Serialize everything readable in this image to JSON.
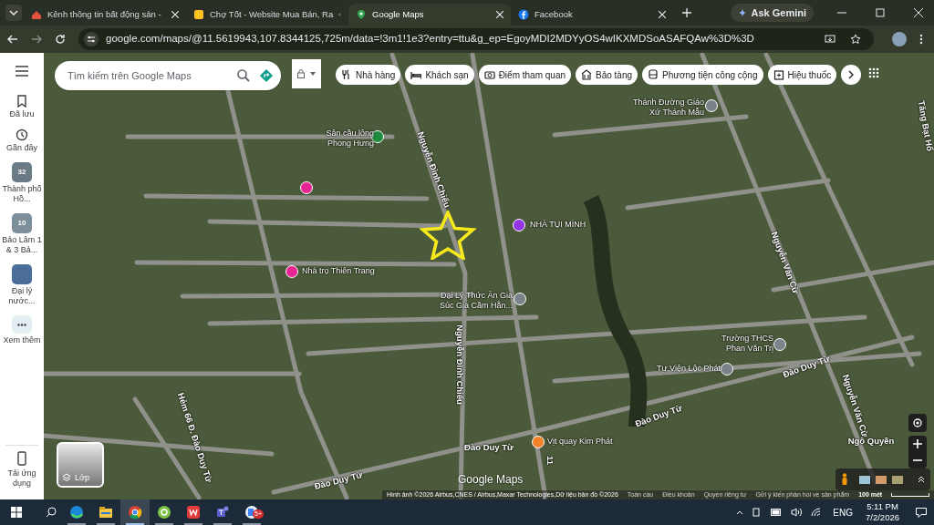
{
  "browser": {
    "tabs": [
      {
        "title": "Kênh thông tin bất động sản -",
        "selected": false
      },
      {
        "title": "Chợ Tốt - Website Mua Bán, Ra",
        "selected": false
      },
      {
        "title": "Google Maps",
        "selected": true
      },
      {
        "title": "Facebook",
        "selected": false
      }
    ],
    "gemini": "Ask Gemini",
    "address": "google.com/maps/@11.5619943,107.8344125,725m/data=!3m1!1e3?entry=ttu&g_ep=EgoyMDI2MDYyOS4wIKXMDSoASAFQAw%3D%3D"
  },
  "sidebar": {
    "items": [
      {
        "kind": "saved",
        "label": "Đã lưu"
      },
      {
        "kind": "recent",
        "label": "Gần đây"
      },
      {
        "kind": "thumb",
        "label": "Thành phố Hồ...",
        "badge": "32"
      },
      {
        "kind": "thumb",
        "label": "Bảo Lâm 1 & 3 Bả...",
        "badge": "10"
      },
      {
        "kind": "thumb",
        "label": "Đại lý nước..."
      },
      {
        "kind": "more",
        "label": "Xem thêm"
      }
    ],
    "download": "Tải ứng dụng"
  },
  "map": {
    "search": {
      "placeholder": "Tìm kiếm trên Google Maps"
    },
    "chips": [
      {
        "label": "Nhà hàng",
        "kind": "restaurant"
      },
      {
        "label": "Khách sạn",
        "kind": "hotel"
      },
      {
        "label": "Điểm tham quan",
        "kind": "camera"
      },
      {
        "label": "Bảo tàng",
        "kind": "museum"
      },
      {
        "label": "Phương tiện công cộng",
        "kind": "transit"
      },
      {
        "label": "Hiệu thuốc",
        "kind": "pharmacy"
      }
    ],
    "pois": [
      {
        "name": "Sân cầu lông Phong Hưng",
        "kind": "sport"
      },
      {
        "kind": "lodging"
      },
      {
        "name": "Nhà trọ Thiên Trang",
        "kind": "lodging"
      },
      {
        "name": "NHÀ TỤI MÌNH",
        "kind": "home"
      },
      {
        "name": "Thánh Đường Giáo Xứ Thánh Mẫu",
        "kind": "church"
      },
      {
        "name": "Đại Lý Thức Ăn Gia Súc Gia Cầm Hằn...",
        "kind": "shop"
      },
      {
        "name": "Trường THCS Phan Văn Trị",
        "kind": "school"
      },
      {
        "name": "Tự Viện Lộc Phát",
        "kind": "temple"
      },
      {
        "name": "Vịt quay Kim Phát",
        "kind": "restaurant"
      }
    ],
    "streets": [
      "Nguyễn Đình Chiểu",
      "Nguyễn Đình Chiểu",
      "Nguyễn Văn Cừ",
      "Nguyễn Văn Cừ",
      "Đào Duy Từ",
      "Đào Duy Từ",
      "Đào Duy Từ",
      "Đào Duy Từ",
      "Hẻm 66 Đ. Đào Duy Từ",
      "Tăng Bạt Hổ",
      "Ngô Quyền",
      "11"
    ],
    "layers_label": "Lớp",
    "logo": "Google Maps",
    "attribution": "Hình ảnh ©2026 Airbus,CNES / Airbus,Maxar Technologies,Dữ liệu bản đồ ©2026",
    "footer_links": [
      "Toàn cầu",
      "Điều khoản",
      "Quyền riêng tư",
      "Gửi ý kiến phản hồi về sản phẩm"
    ],
    "scale": "100 mét"
  },
  "taskbar": {
    "apps": [
      {
        "kind": "edge",
        "active": false
      },
      {
        "kind": "explorer",
        "active": false
      },
      {
        "kind": "chrome",
        "active": true
      },
      {
        "kind": "green",
        "active": false
      },
      {
        "kind": "wps",
        "active": false
      },
      {
        "kind": "teams",
        "active": false
      },
      {
        "kind": "app",
        "active": false,
        "badge": "5+"
      }
    ],
    "language": "ENG",
    "time": "5:11 PM",
    "date": "7/2/2026"
  }
}
